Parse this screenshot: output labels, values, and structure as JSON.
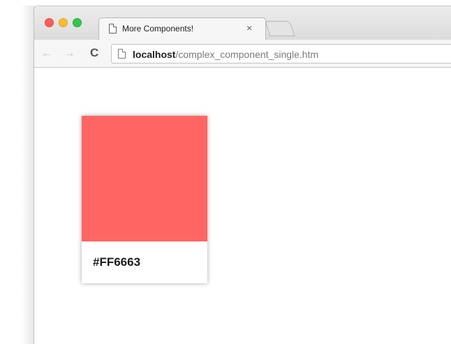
{
  "browser": {
    "tab": {
      "title": "More Components!",
      "close_glyph": "×",
      "icon": "page-icon"
    },
    "toolbar": {
      "back_glyph": "←",
      "forward_glyph": "→",
      "reload_glyph": "C",
      "url_host": "localhost",
      "url_path": "/complex_component_single.htm"
    }
  },
  "card": {
    "color": "#FF6663",
    "label": "#FF6663"
  }
}
